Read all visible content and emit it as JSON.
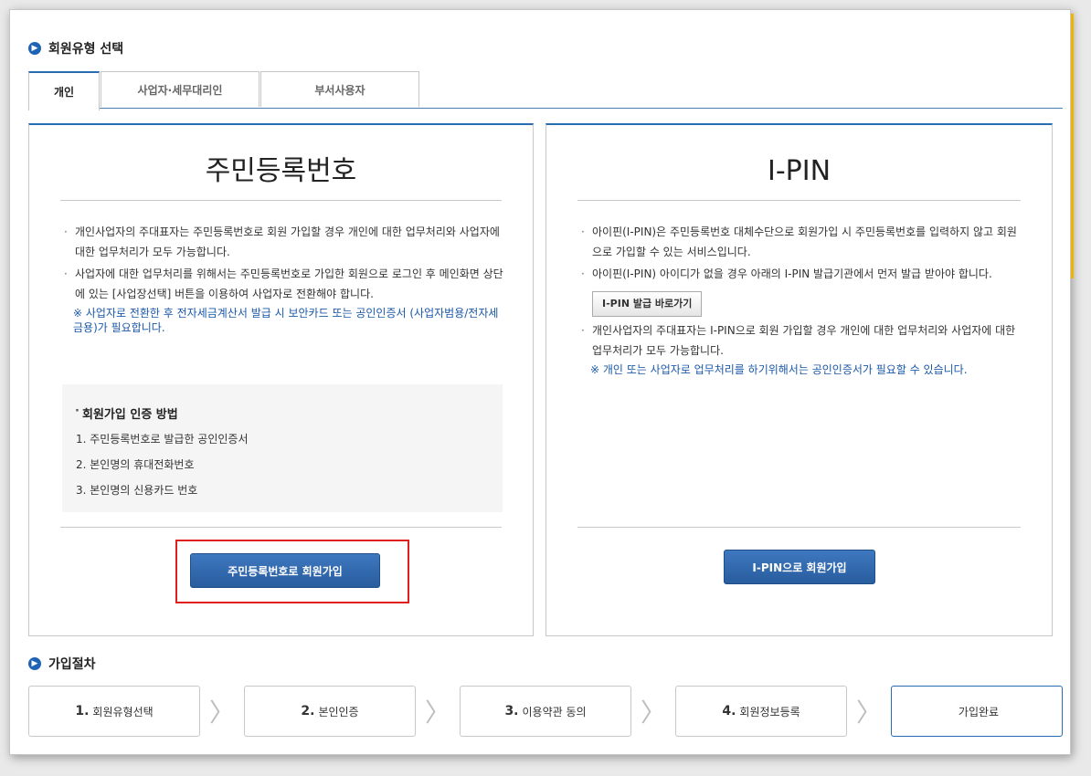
{
  "section_title": "회원유형 선택",
  "tabs": [
    "개인",
    "사업자·세무대리인",
    "부서사용자"
  ],
  "left_panel": {
    "title": "주민등록번호",
    "items": [
      "개인사업자의 주대표자는 주민등록번호로 회원 가입할 경우 개인에 대한 업무처리와 사업자에 대한 업무처리가 모두 가능합니다.",
      "사업자에 대한 업무처리를 위해서는 주민등록번호로 가입한 회원으로 로그인 후 메인화면 상단에 있는 [사업장선택] 버튼을 이용하여 사업자로 전환해야 합니다."
    ],
    "note": "※ 사업자로 전환한 후 전자세금계산서 발급 시 보안카드 또는 공인인증서 (사업자범용/전자세금용)가 필요합니다.",
    "method_title": "회원가입 인증 방법",
    "methods": [
      "1. 주민등록번호로 발급한 공인인증서",
      "2. 본인명의 휴대전화번호",
      "3. 본인명의 신용카드 번호"
    ],
    "button": "주민등록번호로 회원가입"
  },
  "right_panel": {
    "title": "I-PIN",
    "item1": "아이핀(I-PIN)은 주민등록번호 대체수단으로 회원가입 시 주민등록번호를 입력하지 않고 회원으로 가입할 수 있는 서비스입니다.",
    "item2": "아이핀(I-PIN) 아이디가 없을 경우 아래의 I-PIN 발급기관에서 먼저 발급 받아야 합니다.",
    "issue_button": "I-PIN 발급 바로가기",
    "item3": "개인사업자의 주대표자는 I-PIN으로 회원 가입할 경우 개인에 대한 업무처리와 사업자에 대한 업무처리가 모두 가능합니다.",
    "note": "※ 개인 또는 사업자로 업무처리를 하기위해서는 공인인증서가 필요할 수 있습니다.",
    "button": "I-PIN으로 회원가입"
  },
  "process_title": "가입절차",
  "steps": [
    {
      "num": "1.",
      "label": "회원유형선택"
    },
    {
      "num": "2.",
      "label": "본인인증"
    },
    {
      "num": "3.",
      "label": "이용약관 동의"
    },
    {
      "num": "4.",
      "label": "회원정보등록"
    },
    {
      "num": "",
      "label": "가입완료"
    }
  ],
  "colors": {
    "accent": "#2a6cb0",
    "highlight": "#e02020",
    "note": "#1b58a8"
  }
}
